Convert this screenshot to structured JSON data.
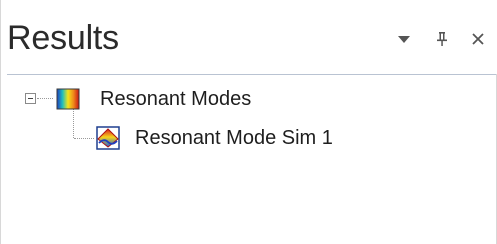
{
  "panel": {
    "title": "Results",
    "buttons": [
      {
        "name": "dropdown",
        "icon": "triangle-down-icon"
      },
      {
        "name": "pin",
        "icon": "pin-icon"
      },
      {
        "name": "close",
        "icon": "close-icon"
      }
    ]
  },
  "tree": {
    "root": {
      "label": "Resonant Modes",
      "icon": "spectrum-folder-icon",
      "expanded": true,
      "children": [
        {
          "label": "Resonant Mode Sim 1",
          "icon": "mode-sim-icon"
        }
      ]
    }
  },
  "colors": {
    "divider": "#b9c3d2",
    "text": "#1e1e1e",
    "icon_gray": "#555555"
  }
}
